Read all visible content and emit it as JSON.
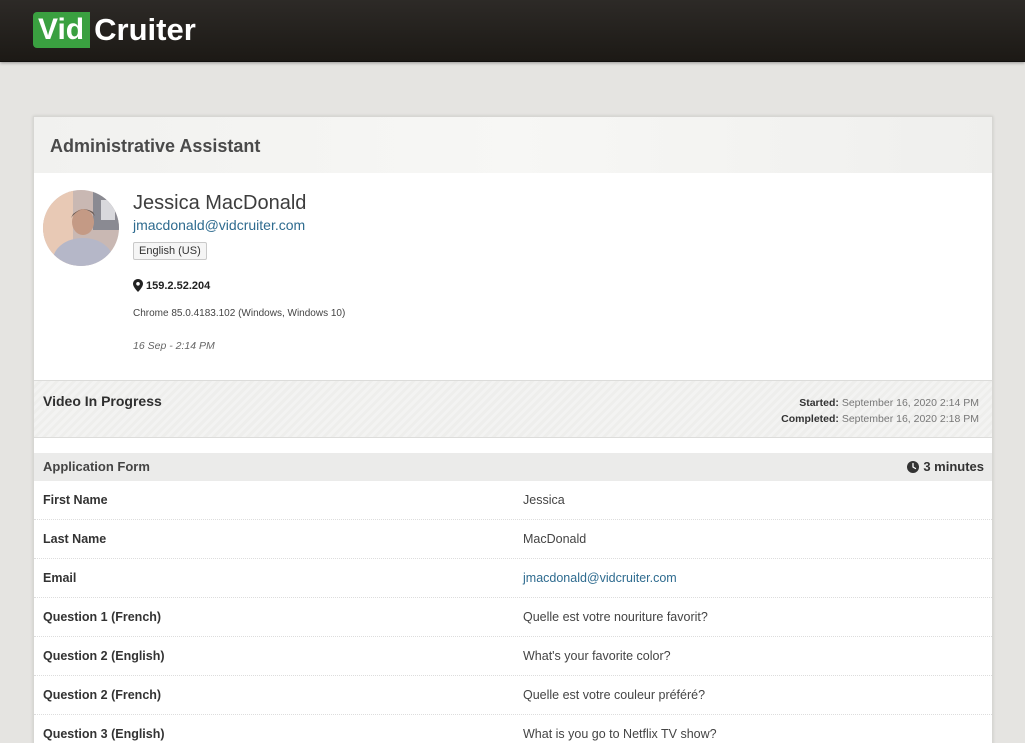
{
  "brand": {
    "logo_part1": "Vid",
    "logo_part2": "Cruiter",
    "green": "#3aa040"
  },
  "job": {
    "title": "Administrative Assistant"
  },
  "candidate": {
    "name": "Jessica MacDonald",
    "email": "jmacdonald@vidcruiter.com",
    "language": "English (US)",
    "ip": "159.2.52.204",
    "browser": "Chrome 85.0.4183.102 (Windows, Windows 10)",
    "date": "16 Sep - 2:14 PM"
  },
  "video": {
    "title": "Video In Progress",
    "started_label": "Started:",
    "started_value": "September 16, 2020 2:14 PM",
    "completed_label": "Completed:",
    "completed_value": "September 16, 2020 2:18 PM"
  },
  "form": {
    "title": "Application Form",
    "duration": "3 minutes",
    "rows": [
      {
        "label": "First Name",
        "value": "Jessica"
      },
      {
        "label": "Last Name",
        "value": "MacDonald"
      },
      {
        "label": "Email",
        "value": "jmacdonald@vidcruiter.com"
      },
      {
        "label": "Question 1 (French)",
        "value": "Quelle est votre nouriture favorit?"
      },
      {
        "label": "Question 2 (English)",
        "value": "What's your favorite color?"
      },
      {
        "label": "Question 2 (French)",
        "value": "Quelle est votre couleur préféré?"
      },
      {
        "label": "Question 3 (English)",
        "value": "What is you go to Netflix TV show?"
      }
    ]
  }
}
